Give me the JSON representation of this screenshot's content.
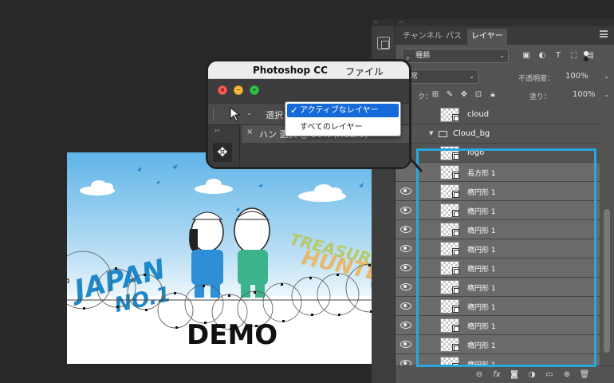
{
  "canvas": {
    "art_title_left": "JAPAN",
    "art_subtitle_left": "NO.1",
    "art_title_right": "TREASURE",
    "art_subtitle_right": "HUNTER",
    "demo_text": "DEMO"
  },
  "panel": {
    "tabs": [
      {
        "label": "チャンネル",
        "active": false
      },
      {
        "label": "パス",
        "active": false
      },
      {
        "label": "レイヤー",
        "active": true
      }
    ],
    "filter": {
      "label": "種類",
      "icon": "search-icon"
    },
    "blend_mode": "通常",
    "opacity_label": "不透明度：",
    "opacity_value": "100%",
    "lock_label": "ク：",
    "fill_label": "塗り：",
    "fill_value": "100%",
    "layers": [
      {
        "name": "cloud",
        "visible": false,
        "type": "layer"
      },
      {
        "name": "Cloud_bg",
        "visible": false,
        "type": "group"
      },
      {
        "name": "logo",
        "visible": false,
        "type": "layer"
      },
      {
        "name": "長方形 1",
        "visible": false,
        "type": "layer"
      },
      {
        "name": "楕円形 1",
        "visible": true,
        "type": "layer"
      },
      {
        "name": "楕円形 1",
        "visible": true,
        "type": "layer"
      },
      {
        "name": "楕円形 1",
        "visible": true,
        "type": "layer"
      },
      {
        "name": "楕円形 1",
        "visible": true,
        "type": "layer"
      },
      {
        "name": "楕円形 1",
        "visible": true,
        "type": "layer"
      },
      {
        "name": "楕円形 1",
        "visible": true,
        "type": "layer"
      },
      {
        "name": "楕円形 1",
        "visible": true,
        "type": "layer"
      },
      {
        "name": "楕円形 1",
        "visible": true,
        "type": "layer"
      },
      {
        "name": "楕円形 1",
        "visible": true,
        "type": "layer"
      },
      {
        "name": "楕円形 1",
        "visible": true,
        "type": "layer"
      }
    ],
    "selection_color": "#29a7e1"
  },
  "callout": {
    "menubar": {
      "apple": "",
      "app_name": "Photoshop CC",
      "menu_file": "ファイル"
    },
    "options": {
      "select_label": "選択"
    },
    "dropdown": [
      {
        "label": "アクティブなレイヤー",
        "selected": true
      },
      {
        "label": "すべてのレイヤー",
        "selected": false
      }
    ],
    "doc_tab_title": "ハン 選択 @ 50% (RGB/8)"
  }
}
